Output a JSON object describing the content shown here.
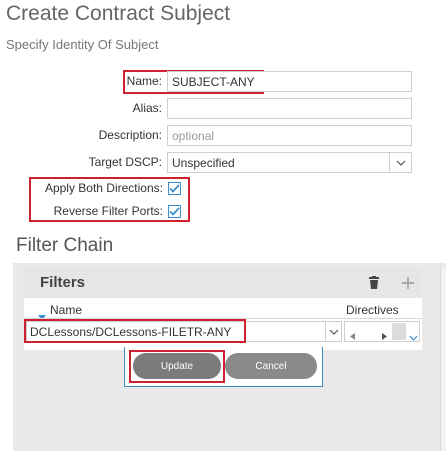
{
  "header": {
    "title": "Create Contract Subject",
    "subtitle": "Specify Identity Of Subject"
  },
  "form": {
    "name_label": "Name:",
    "name_value": "SUBJECT-ANY",
    "alias_label": "Alias:",
    "alias_value": "",
    "description_label": "Description:",
    "description_placeholder": "optional",
    "target_dscp_label": "Target DSCP:",
    "target_dscp_value": "Unspecified",
    "apply_both_directions_label": "Apply Both Directions:",
    "apply_both_directions_checked": true,
    "reverse_filter_ports_label": "Reverse Filter Ports:",
    "reverse_filter_ports_checked": true
  },
  "filter_chain": {
    "title": "Filter Chain",
    "filters_title": "Filters",
    "columns": {
      "name": "Name",
      "directives": "Directives"
    },
    "row": {
      "filter_value": "DCLessons/DCLessons-FILETR-ANY"
    },
    "update_label": "Update",
    "cancel_label": "Cancel"
  },
  "colors": {
    "highlight_red": "#d0202f",
    "accent_blue": "#3a8fc8",
    "button_gray": "#7b7b7b"
  },
  "icons": {
    "delete": "trash-icon",
    "add": "plus-icon",
    "sort": "sort-down-icon",
    "dropdown": "chevron-down-icon"
  }
}
